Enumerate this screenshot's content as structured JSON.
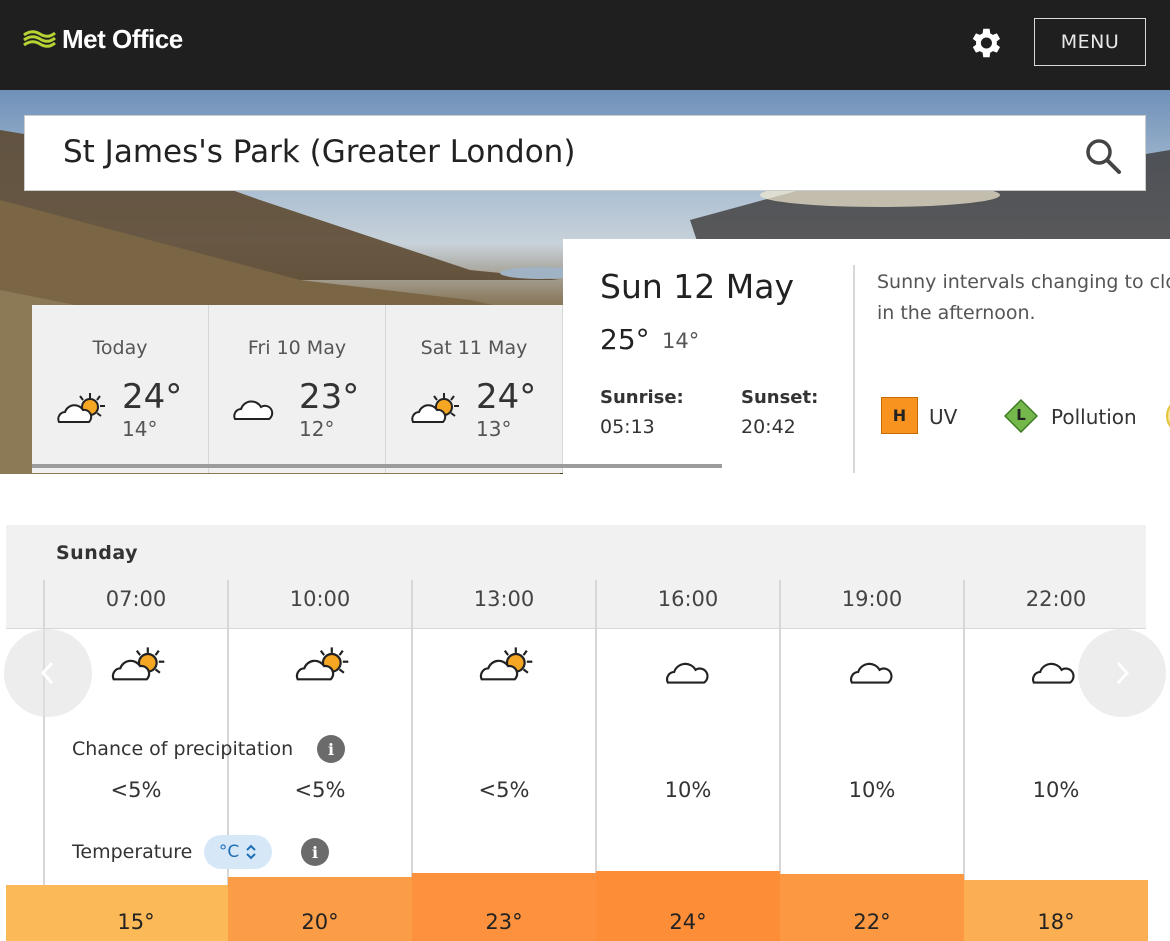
{
  "header": {
    "brand": "Met Office",
    "menu_label": "MENU",
    "settings_icon": "gear-icon",
    "logo_icon": "met-office-logo"
  },
  "search": {
    "value": "St James's Park (Greater London)",
    "icon": "search-icon"
  },
  "days": [
    {
      "label": "Today",
      "max": "24°",
      "min": "14°",
      "icon": "sunny-intervals"
    },
    {
      "label": "Fri 10 May",
      "max": "23°",
      "min": "12°",
      "icon": "cloudy"
    },
    {
      "label": "Sat 11 May",
      "max": "24°",
      "min": "13°",
      "icon": "sunny-intervals"
    }
  ],
  "selected_day": {
    "date": "Sun 12 May",
    "max": "25°",
    "min": "14°",
    "sunrise_label": "Sunrise:",
    "sunrise": "05:13",
    "sunset_label": "Sunset:",
    "sunset": "20:42",
    "summary_line1": "Sunny intervals changing to clou",
    "summary_line2": "in the afternoon.",
    "uv_level": "H",
    "uv_label": "UV",
    "pollution_level": "L",
    "pollution_label": "Pollution",
    "colors": {
      "uv": "#f7931e",
      "pollution": "#74b74a"
    }
  },
  "hourly": {
    "day_name": "Sunday",
    "precip_label": "Chance of precipitation",
    "temp_label": "Temperature",
    "unit": "°C",
    "times": [
      "07:00",
      "10:00",
      "13:00",
      "16:00",
      "19:00",
      "22:00"
    ],
    "icons": [
      "sunny-intervals",
      "sunny-intervals",
      "sunny-intervals",
      "cloudy",
      "cloudy",
      "cloudy"
    ],
    "precip": [
      "<5%",
      "<5%",
      "<5%",
      "10%",
      "10%",
      "10%"
    ],
    "temps": [
      "15°",
      "20°",
      "23°",
      "24°",
      "22°",
      "18°"
    ],
    "temp_colors": [
      "#fbb957",
      "#fb9c46",
      "#fd913d",
      "#fd8d37",
      "#fc9742",
      "#fcae52"
    ]
  }
}
